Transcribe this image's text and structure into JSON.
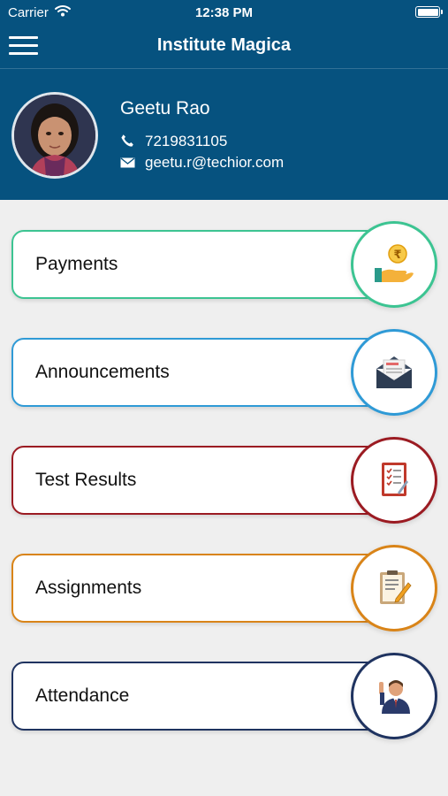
{
  "status_bar": {
    "carrier": "Carrier",
    "time": "12:38 PM"
  },
  "navbar": {
    "title": "Institute Magica",
    "menu_icon": "hamburger-menu-icon"
  },
  "profile": {
    "name": "Geetu Rao",
    "phone": "7219831105",
    "email": "geetu.r@techior.com",
    "avatar_icon": "user-photo"
  },
  "menu": [
    {
      "label": "Payments",
      "icon": "rupee-payment-hand-icon",
      "color": "#3cc492"
    },
    {
      "label": "Announcements",
      "icon": "envelope-letter-icon",
      "color": "#2f9ad6"
    },
    {
      "label": "Test Results",
      "icon": "checklist-clipboard-icon",
      "color": "#9b1b22"
    },
    {
      "label": "Assignments",
      "icon": "notepad-pencil-icon",
      "color": "#d98418"
    },
    {
      "label": "Attendance",
      "icon": "student-raising-hand-icon",
      "color": "#1f3360"
    }
  ],
  "colors": {
    "header": "#06527f",
    "background": "#efefef"
  }
}
